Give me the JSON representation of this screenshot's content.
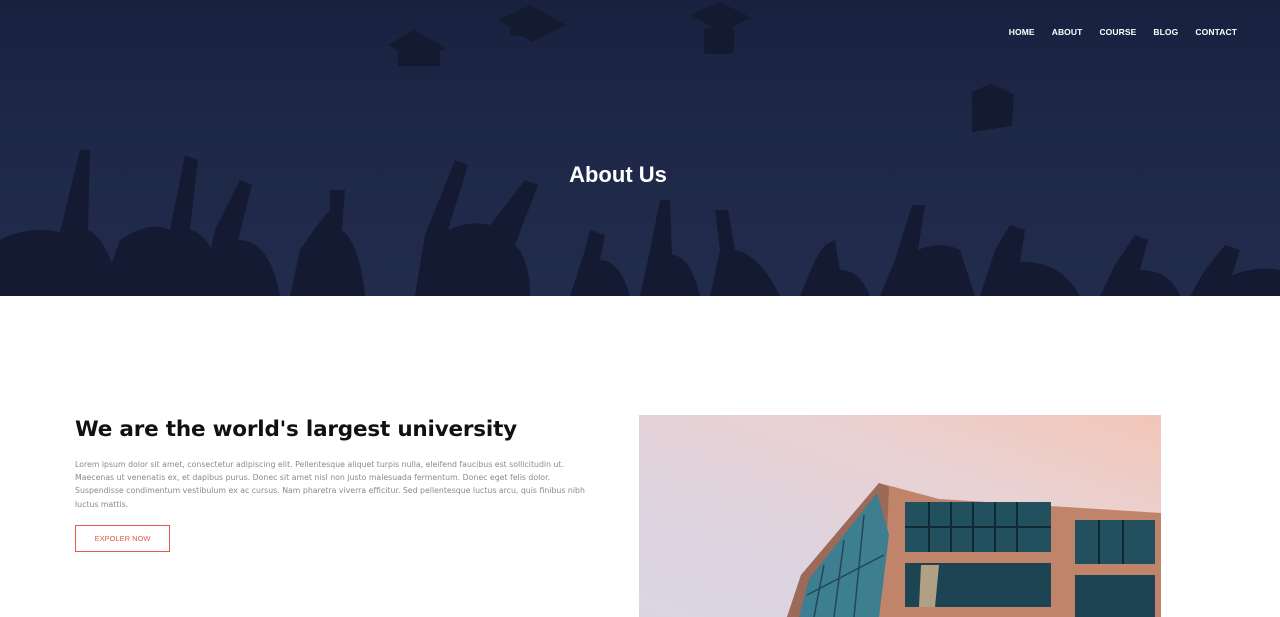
{
  "nav": {
    "items": [
      "HOME",
      "ABOUT",
      "COURSE",
      "BLOG",
      "CONTACT"
    ]
  },
  "hero": {
    "title": "About Us",
    "image": "graduates-throwing-caps"
  },
  "about": {
    "heading": "We are the world's largest university",
    "body": "Lorem ipsum dolor sit amet, consectetur adipiscing elit. Pellentesque aliquet turpis nulla, eleifend faucibus est sollicitudin ut. Maecenas ut venenatis ex, et dapibus purus. Donec sit amet nisl non justo malesuada fermentum. Donec eget felis dolor. Suspendisse condimentum vestibulum ex ac cursus. Nam pharetra viverra efficitur. Sed pellentesque luctus arcu, quis finibus nibh luctus mattis.",
    "button_label": "EXPOLER NOW",
    "image": "modern-glass-building"
  },
  "colors": {
    "accent": "#e05a4f",
    "hero_overlay": "#1b2441"
  }
}
